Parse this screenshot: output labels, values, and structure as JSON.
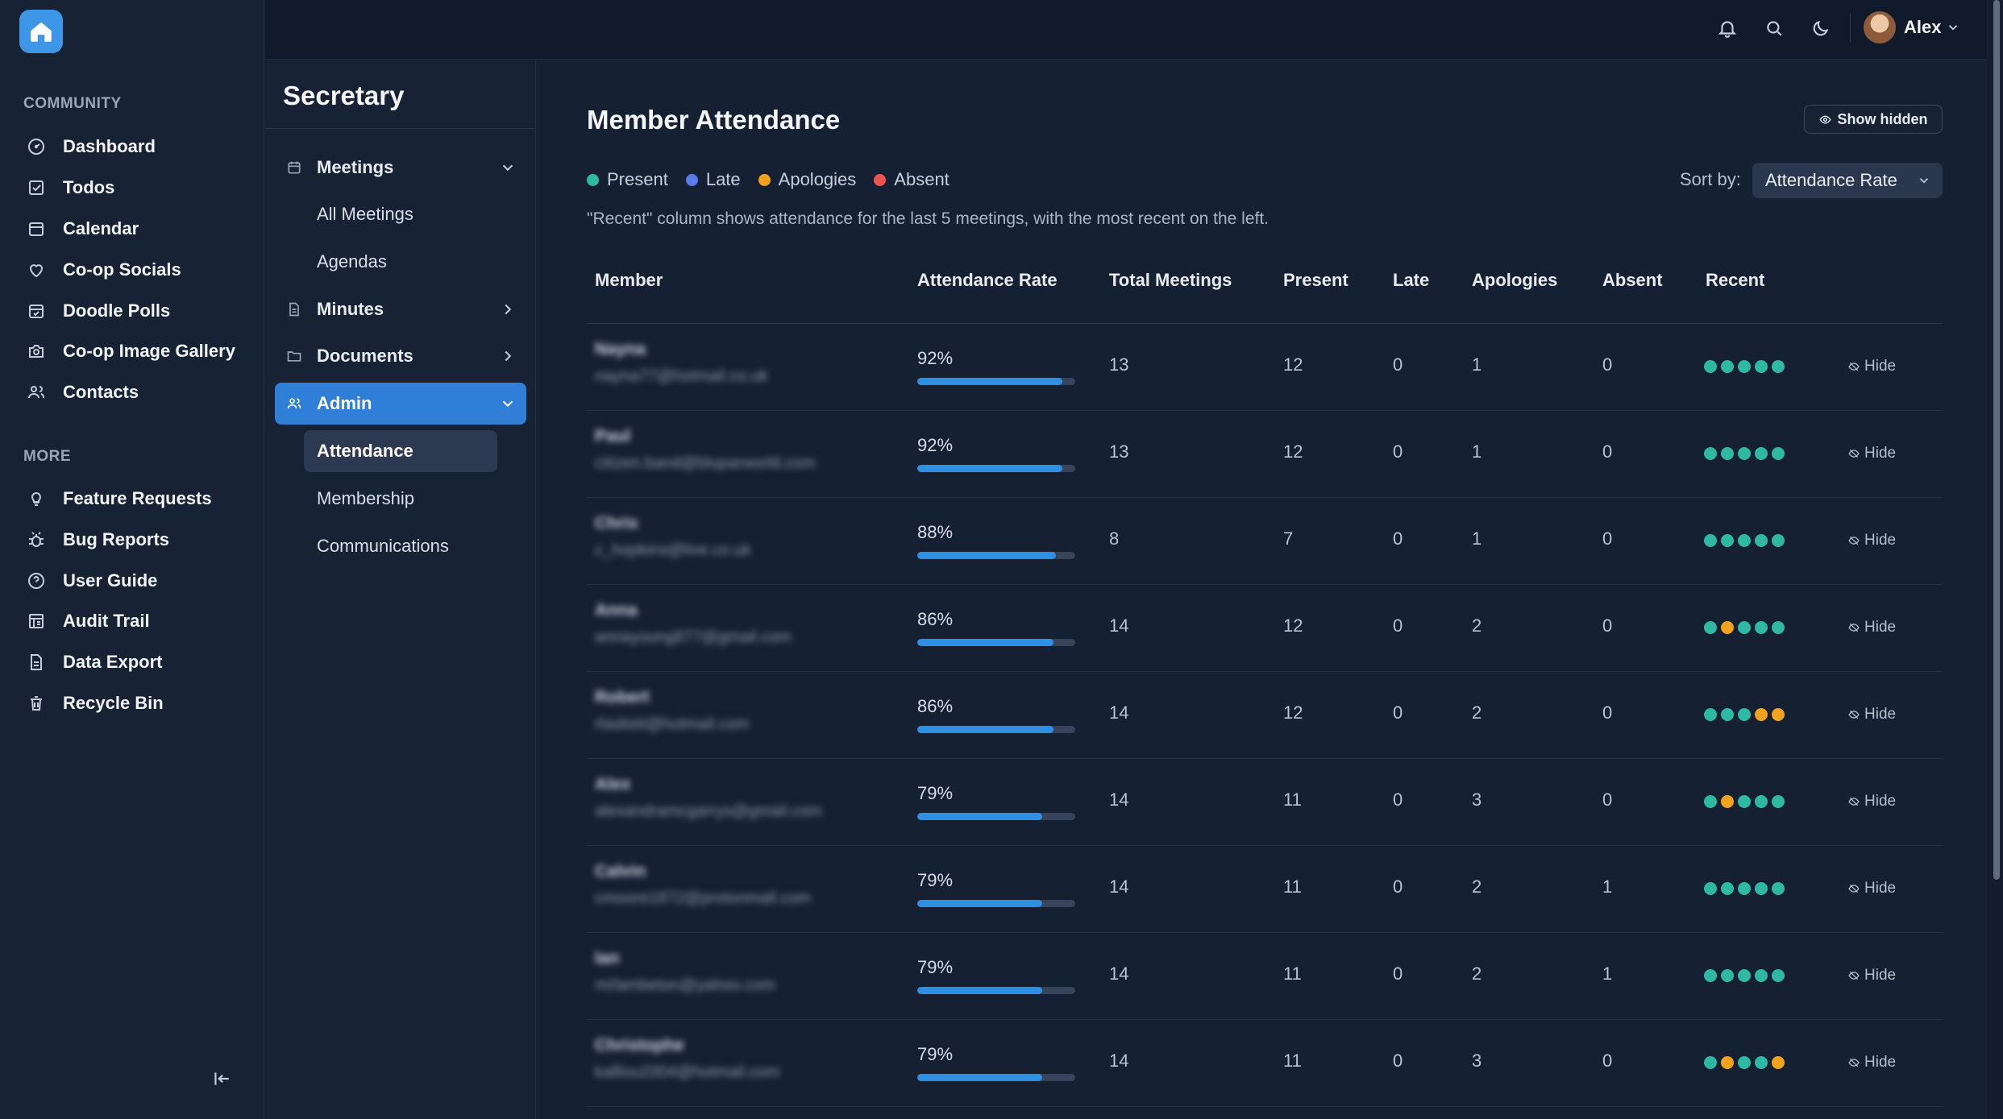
{
  "sidebar": {
    "community_label": "COMMUNITY",
    "more_label": "MORE",
    "community_items": [
      {
        "label": "Dashboard",
        "icon": "dashboard-icon"
      },
      {
        "label": "Todos",
        "icon": "checkbox-icon"
      },
      {
        "label": "Calendar",
        "icon": "calendar-icon"
      },
      {
        "label": "Co-op Socials",
        "icon": "heart-icon"
      },
      {
        "label": "Doodle Polls",
        "icon": "calendar-check-icon"
      },
      {
        "label": "Co-op Image Gallery",
        "icon": "camera-icon"
      },
      {
        "label": "Contacts",
        "icon": "users-icon"
      }
    ],
    "more_items": [
      {
        "label": "Feature Requests",
        "icon": "lightbulb-icon"
      },
      {
        "label": "Bug Reports",
        "icon": "bug-icon"
      },
      {
        "label": "User Guide",
        "icon": "help-circle-icon"
      },
      {
        "label": "Audit Trail",
        "icon": "history-icon"
      },
      {
        "label": "Data Export",
        "icon": "file-export-icon"
      },
      {
        "label": "Recycle Bin",
        "icon": "trash-icon"
      }
    ]
  },
  "topbar": {
    "user_name": "Alex"
  },
  "subnav": {
    "title": "Secretary",
    "groups": {
      "meetings": "Meetings",
      "minutes": "Minutes",
      "documents": "Documents",
      "admin": "Admin"
    },
    "meetings_items": [
      "All Meetings",
      "Agendas"
    ],
    "admin_items": [
      "Attendance",
      "Membership",
      "Communications"
    ]
  },
  "main": {
    "title": "Member Attendance",
    "show_hidden_label": "Show hidden",
    "legend": [
      {
        "label": "Present",
        "color": "#2fb9a5"
      },
      {
        "label": "Late",
        "color": "#5b7be8"
      },
      {
        "label": "Apologies",
        "color": "#f2a21c"
      },
      {
        "label": "Absent",
        "color": "#ef5350"
      }
    ],
    "sort_label": "Sort by:",
    "sort_value": "Attendance Rate",
    "hint": "\"Recent\" column shows attendance for the last 5 meetings, with the most recent on the left.",
    "hide_label": "Hide",
    "columns": [
      "Member",
      "Attendance Rate",
      "Total Meetings",
      "Present",
      "Late",
      "Apologies",
      "Absent",
      "Recent"
    ],
    "rows": [
      {
        "name": "Nayna",
        "email": "nayna77@hotmail.co.uk",
        "rate": "92%",
        "rate_value": 0.92,
        "total": "13",
        "present": "12",
        "late": "0",
        "apologies": "1",
        "absent": "0",
        "recent": [
          "present",
          "present",
          "present",
          "present",
          "present"
        ]
      },
      {
        "name": "Paul",
        "email": "citizen.band@bluparworld.com",
        "rate": "92%",
        "rate_value": 0.92,
        "total": "13",
        "present": "12",
        "late": "0",
        "apologies": "1",
        "absent": "0",
        "recent": [
          "present",
          "present",
          "present",
          "present",
          "present"
        ]
      },
      {
        "name": "Chris",
        "email": "c_hopkins@live.co.uk",
        "rate": "88%",
        "rate_value": 0.88,
        "total": "8",
        "present": "7",
        "late": "0",
        "apologies": "1",
        "absent": "0",
        "recent": [
          "present",
          "present",
          "present",
          "present",
          "present"
        ]
      },
      {
        "name": "Anna",
        "email": "annayoung877@gmail.com",
        "rate": "86%",
        "rate_value": 0.86,
        "total": "14",
        "present": "12",
        "late": "0",
        "apologies": "2",
        "absent": "0",
        "recent": [
          "present",
          "apologies",
          "present",
          "present",
          "present"
        ]
      },
      {
        "name": "Robert",
        "email": "rlasketi@hotmail.com",
        "rate": "86%",
        "rate_value": 0.86,
        "total": "14",
        "present": "12",
        "late": "0",
        "apologies": "2",
        "absent": "0",
        "recent": [
          "present",
          "present",
          "present",
          "apologies",
          "apologies"
        ]
      },
      {
        "name": "Alex",
        "email": "alexandramcgarrys@gmail.com",
        "rate": "79%",
        "rate_value": 0.79,
        "total": "14",
        "present": "11",
        "late": "0",
        "apologies": "3",
        "absent": "0",
        "recent": [
          "present",
          "apologies",
          "present",
          "present",
          "present"
        ]
      },
      {
        "name": "Calvin",
        "email": "cmoore1872@protonmail.com",
        "rate": "79%",
        "rate_value": 0.79,
        "total": "14",
        "present": "11",
        "late": "0",
        "apologies": "2",
        "absent": "1",
        "recent": [
          "present",
          "present",
          "present",
          "present",
          "present"
        ]
      },
      {
        "name": "Ian",
        "email": "mrlambeton@yahoo.com",
        "rate": "79%",
        "rate_value": 0.79,
        "total": "14",
        "present": "11",
        "late": "0",
        "apologies": "2",
        "absent": "1",
        "recent": [
          "present",
          "present",
          "present",
          "present",
          "present"
        ]
      },
      {
        "name": "Christophe",
        "email": "kalliou2004@hotmail.com",
        "rate": "79%",
        "rate_value": 0.79,
        "total": "14",
        "present": "11",
        "late": "0",
        "apologies": "3",
        "absent": "0",
        "recent": [
          "present",
          "apologies",
          "present",
          "present",
          "apologies"
        ]
      }
    ]
  }
}
